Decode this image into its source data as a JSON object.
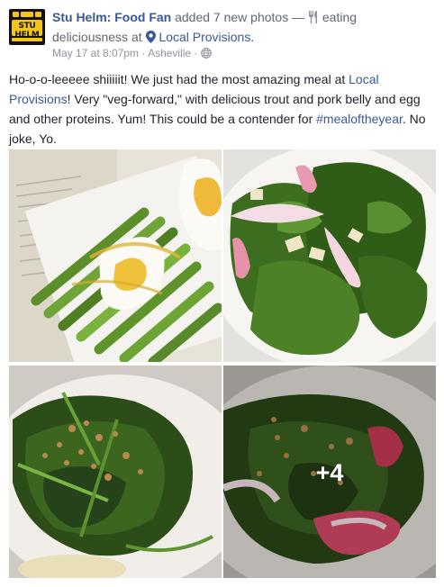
{
  "post": {
    "author": "Stu Helm: Food Fan",
    "action": " added 7 new photos — ",
    "activity": " eating deliciousness at ",
    "place": "Local Provisions.",
    "timestamp": "May 17 at 8:07pm",
    "separator": " · ",
    "location": "Asheville",
    "separator2": " · ",
    "icons": {
      "activity": "fork-knife-icon",
      "place": "map-pin-icon",
      "privacy": "globe-icon"
    },
    "text_parts": [
      "Ho-o-o-leeeee shiiiiit! We just had the most amazing meal at ",
      "Local Provisions",
      "! Very \"veg-forward,\" with delicious trout and pork belly and egg and other proteins. Yum! This could be a contender for ",
      "#mealoftheyear",
      ". No joke, Yo."
    ],
    "avatar": {
      "logo_text": "STU HELM"
    }
  },
  "photos": {
    "items": [
      {
        "alt": "asparagus with egg"
      },
      {
        "alt": "greens with radish"
      },
      {
        "alt": "broccoli rabe with granola"
      },
      {
        "alt": "broccoli rabe with radish"
      }
    ],
    "more_label": "+4"
  },
  "colors": {
    "link": "#385898",
    "text": "#1d2129",
    "meta": "#90949c",
    "secondary": "#606770"
  }
}
